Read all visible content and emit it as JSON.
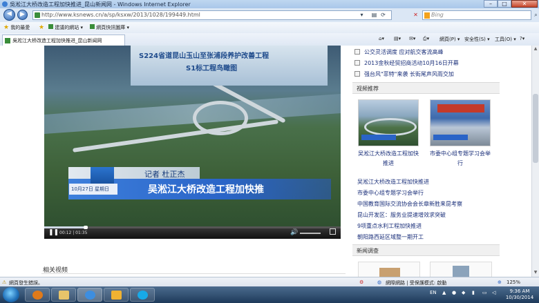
{
  "window": {
    "title": "吳淞江大桥改造工程加快推进_昆山新闻网 - Windows Internet Explorer",
    "minimize_label": "–",
    "maximize_label": "□",
    "close_label": "✕"
  },
  "address_bar": {
    "url": "http://www.ksnews.cn/a/sp/ksxw/2013/1028/199449.html",
    "search_placeholder": "Bing"
  },
  "favorites_bar": {
    "favorites_label": "我的最愛",
    "items": [
      {
        "label": "建議的網站 ▾"
      },
      {
        "label": "網頁快訊圖庫 ▾"
      }
    ]
  },
  "tabs": [
    {
      "label": "吳淞江大桥改造工程加快推进_昆山新闻网"
    }
  ],
  "command_bar": {
    "page_label": "網頁(P) ▾",
    "safety_label": "安全性(S) ▾",
    "tools_label": "工具(O) ▾",
    "help_label": "?▾"
  },
  "video": {
    "board_line1": "S224省道昆山玉山至张浦段养护改善工程",
    "board_line2": "S1标工程鸟瞰图",
    "reporter": "记者 杜正杰",
    "date_caption": "10月27日 星期日",
    "headline": "吴淞江大桥改造工程加快推",
    "progress_fraction": 0.14,
    "current_time": "00:12",
    "duration": "01:35"
  },
  "related_videos_label": "相关视频",
  "top_links": [
    "公交灵活调度 应对航交客流高峰",
    "2013金秋经贸招商活动10月16日开幕",
    "强台风\"菲特\"来袭 长街尾声风雨交加"
  ],
  "video_recommend": {
    "title": "视频推荐",
    "items": [
      {
        "caption_line1": "吴淞江大桥改造工程加快",
        "caption_line2": "推进"
      },
      {
        "caption_line1": "市委中心组专题学习会举",
        "caption_line2": "行"
      }
    ],
    "links": [
      "吴淞江大桥改造工程加快推进",
      "市委中心组专题学习会举行",
      "中国教育国际交流协会会长章新胜来昆考察",
      "昆山开发区：服务业提速增效求突破",
      "9项重点水利工程加快推进",
      "朝阳路西延区域整一期开工"
    ]
  },
  "news_survey": {
    "title": "新闻调查"
  },
  "status_bar": {
    "left_text": "網頁發生錯誤。",
    "zone_text": "網際網路 | 受保護模式: 啟動",
    "zoom": "125%"
  },
  "taskbar": {
    "language": "EN",
    "time": "9:36 AM",
    "date": "10/30/2014"
  },
  "colors": {
    "link": "#1a2f7a",
    "accent": "#2a64c7",
    "close_button": "#c6462b"
  }
}
